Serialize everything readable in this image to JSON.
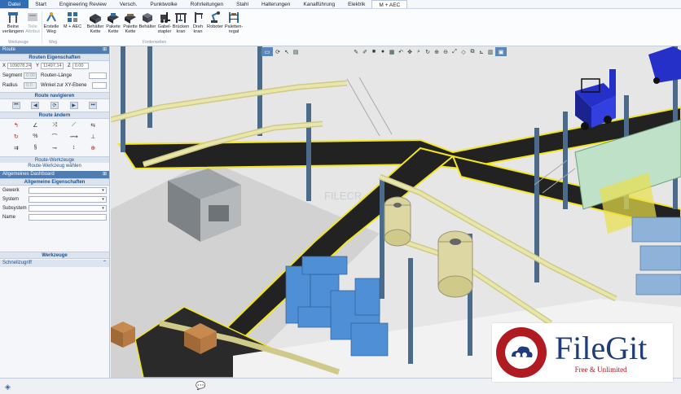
{
  "menu": {
    "tabs": [
      "Datei",
      "Start",
      "Engineering Review",
      "Versch.",
      "Punktwolke",
      "Rohrleitungen",
      "Stahl",
      "Halterungen",
      "Kanalführung",
      "Elektrik",
      "M + AEC"
    ]
  },
  "ribbon": {
    "buttons": [
      {
        "label": "Beine verlängern",
        "icon": "extend-legs-icon"
      },
      {
        "label": "Teile Attribut",
        "icon": "part-attribute-icon"
      },
      {
        "label": "Erstelle Weg",
        "icon": "create-path-icon"
      },
      {
        "label": "M + AEC",
        "icon": "m-aec-icon"
      },
      {
        "label": "Behälter Kette",
        "icon": "container-chain-icon"
      },
      {
        "label": "Pakete Kette",
        "icon": "package-chain-icon"
      },
      {
        "label": "Palette Kette",
        "icon": "pallet-chain-icon"
      },
      {
        "label": "Behälter",
        "icon": "container-icon"
      },
      {
        "label": "Gabel-stapler",
        "icon": "forklift-icon"
      },
      {
        "label": "Brücken kran",
        "icon": "bridge-crane-icon"
      },
      {
        "label": "Dreh kran",
        "icon": "jib-crane-icon"
      },
      {
        "label": "Roboter",
        "icon": "robot-icon"
      },
      {
        "label": "Paletten-regal",
        "icon": "pallet-rack-icon"
      }
    ],
    "groups": [
      "Werkzeuge",
      "Weg",
      "Förderwelten"
    ]
  },
  "route_panel": {
    "title": "Route",
    "props_header": "Routen Eigenschaften",
    "x_label": "X",
    "x_value": "109078.24",
    "y_label": "Y",
    "y_value": "11497.14",
    "z_label": "Z",
    "z_value": "0.00",
    "segment_label": "Segment",
    "segment_value": "0.00",
    "length_label": "Routen-Länge",
    "radius_label": "Radius",
    "radius_value": "0.0",
    "angle_label": "Winkel zur XY-Ebene",
    "navigate_header": "Route navigieren",
    "change_header": "Route ändern",
    "tools_link": "Route-Werkzeuge",
    "select_tool_link": "Route-Werkzeug wählen"
  },
  "dashboard_panel": {
    "title": "Allgemeines Dashboard",
    "props_header": "Allgemeine Eigenschaften",
    "fields": [
      "Gewerk",
      "System",
      "Subsystem",
      "Name"
    ],
    "tools_header": "Werkzeuge",
    "quick_access": "Schnellzugriff"
  },
  "watermark": {
    "title": "FileGit",
    "subtitle": "Free & Unlimited",
    "faint_text": "FILECR"
  },
  "colors": {
    "accent": "#2f6db5",
    "panel_title": "#4f7db1",
    "selected_equipment": "#4f8fd6",
    "conveyor": "#e8e6a8",
    "floor_path": "#222222",
    "floor_edge": "#f2e51c",
    "forklift": "#2430c8",
    "brand_red": "#b01b22"
  }
}
